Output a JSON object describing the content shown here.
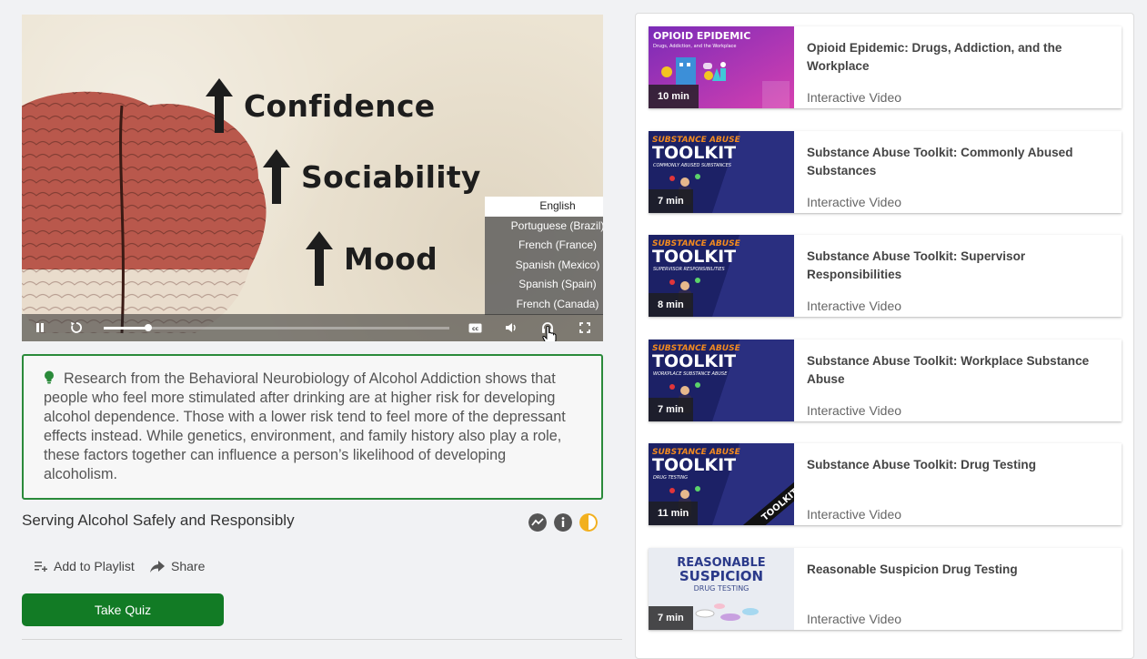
{
  "video": {
    "slide_lines": [
      "Confidence",
      "Sociability",
      "Mood"
    ],
    "languages": [
      "English",
      "Portuguese (Brazil)",
      "French (France)",
      "Spanish (Mexico)",
      "Spanish (Spain)",
      "French (Canada)"
    ],
    "selected_language": "English",
    "progress": 0.13,
    "cc_label": "cc"
  },
  "callout": {
    "text": "Research from the Behavioral Neurobiology of Alcohol Addiction shows that people who feel more stimulated after drinking are at higher risk for developing alcohol dependence. Those with a lower risk tend to feel more of the depressant effects instead. While genetics, environment, and family history also play a role, these factors together can influence a person’s likelihood of developing alcoholism."
  },
  "title": "Serving Alcohol Safely and Responsibly",
  "actions": {
    "playlist": "Add to Playlist",
    "share": "Share"
  },
  "quiz_button": "Take Quiz",
  "colors": {
    "accent_green": "#127b25",
    "callout_border": "#2a8a3a",
    "toolkit_navy": "#1c2166",
    "toolkit_orange": "#f28a1f"
  },
  "playlist": [
    {
      "title": "Opioid Epidemic: Drugs, Addiction, and the Workplace",
      "type": "Interactive Video",
      "duration": "10 min",
      "thumb_title": "OPIOID EPIDEMIC",
      "thumb_sub": "Drugs, Addiction, and the Workplace"
    },
    {
      "title": "Substance Abuse Toolkit: Commonly Abused Substances",
      "type": "Interactive Video",
      "duration": "7 min",
      "thumb_kicker": "SUBSTANCE ABUSE",
      "thumb_title": "TOOLKIT",
      "thumb_sub": "COMMONLY ABUSED SUBSTANCES"
    },
    {
      "title": "Substance Abuse Toolkit: Supervisor Responsibilities",
      "type": "Interactive Video",
      "duration": "8 min",
      "thumb_kicker": "SUBSTANCE ABUSE",
      "thumb_title": "TOOLKIT",
      "thumb_sub": "SUPERVISOR RESPONSIBILITIES"
    },
    {
      "title": "Substance Abuse Toolkit: Workplace Substance Abuse",
      "type": "Interactive Video",
      "duration": "7 min",
      "thumb_kicker": "SUBSTANCE ABUSE",
      "thumb_title": "TOOLKIT",
      "thumb_sub": "WORKPLACE SUBSTANCE ABUSE"
    },
    {
      "title": "Substance Abuse Toolkit: Drug Testing",
      "type": "Interactive Video",
      "duration": "11 min",
      "thumb_kicker": "SUBSTANCE ABUSE",
      "thumb_title": "TOOLKIT",
      "thumb_sub": "DRUG TESTING",
      "thumb_banner": "TOOLKIT"
    },
    {
      "title": "Reasonable Suspicion Drug Testing",
      "type": "Interactive Video",
      "duration": "7 min",
      "thumb_kicker": "REASONABLE",
      "thumb_title": "SUSPICION",
      "thumb_sub": "DRUG TESTING"
    }
  ]
}
